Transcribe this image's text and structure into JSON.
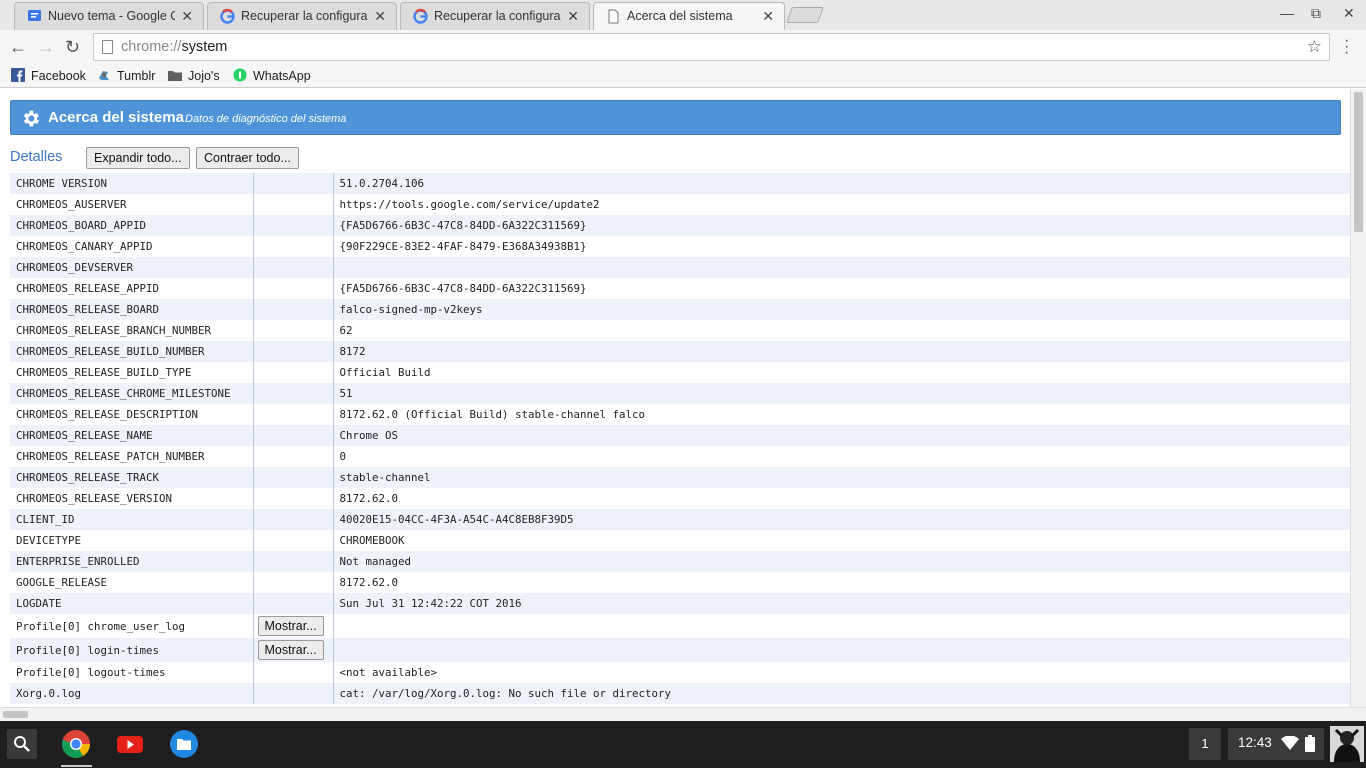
{
  "browser": {
    "tabs": [
      {
        "title": "Nuevo tema - Google Ch",
        "favicon": "comment-icon",
        "active": false
      },
      {
        "title": "Recuperar la configuraci",
        "favicon": "google-icon",
        "active": false
      },
      {
        "title": "Recuperar la configuraci",
        "favicon": "google-icon",
        "active": false
      },
      {
        "title": "Acerca del sistema",
        "favicon": "page-icon",
        "active": true
      }
    ],
    "url_scheme": "chrome://",
    "url_host": "system",
    "bookmarks": [
      {
        "label": "Facebook",
        "icon": "facebook-icon"
      },
      {
        "label": "Tumblr",
        "icon": "tumblr-icon"
      },
      {
        "label": "Jojo's",
        "icon": "folder-icon"
      },
      {
        "label": "WhatsApp",
        "icon": "whatsapp-icon"
      }
    ]
  },
  "page": {
    "title": "Acerca del sistema",
    "subtitle": "Datos de diagnóstico del sistema",
    "details_label": "Detalles",
    "expand_all": "Expandir todo...",
    "collapse_all": "Contraer todo...",
    "show_label": "Mostrar...",
    "rows": [
      {
        "key": "CHROME VERSION",
        "value": "51.0.2704.106"
      },
      {
        "key": "CHROMEOS_AUSERVER",
        "value": "https://tools.google.com/service/update2"
      },
      {
        "key": "CHROMEOS_BOARD_APPID",
        "value": "{FA5D6766-6B3C-47C8-84DD-6A322C311569}"
      },
      {
        "key": "CHROMEOS_CANARY_APPID",
        "value": "{90F229CE-83E2-4FAF-8479-E368A34938B1}"
      },
      {
        "key": "CHROMEOS_DEVSERVER",
        "value": ""
      },
      {
        "key": "CHROMEOS_RELEASE_APPID",
        "value": "{FA5D6766-6B3C-47C8-84DD-6A322C311569}"
      },
      {
        "key": "CHROMEOS_RELEASE_BOARD",
        "value": "falco-signed-mp-v2keys"
      },
      {
        "key": "CHROMEOS_RELEASE_BRANCH_NUMBER",
        "value": "62"
      },
      {
        "key": "CHROMEOS_RELEASE_BUILD_NUMBER",
        "value": "8172"
      },
      {
        "key": "CHROMEOS_RELEASE_BUILD_TYPE",
        "value": "Official Build"
      },
      {
        "key": "CHROMEOS_RELEASE_CHROME_MILESTONE",
        "value": "51"
      },
      {
        "key": "CHROMEOS_RELEASE_DESCRIPTION",
        "value": "8172.62.0 (Official Build) stable-channel falco"
      },
      {
        "key": "CHROMEOS_RELEASE_NAME",
        "value": "Chrome OS"
      },
      {
        "key": "CHROMEOS_RELEASE_PATCH_NUMBER",
        "value": "0"
      },
      {
        "key": "CHROMEOS_RELEASE_TRACK",
        "value": "stable-channel"
      },
      {
        "key": "CHROMEOS_RELEASE_VERSION",
        "value": "8172.62.0"
      },
      {
        "key": "CLIENT_ID",
        "value": "40020E15-04CC-4F3A-A54C-A4C8EB8F39D5"
      },
      {
        "key": "DEVICETYPE",
        "value": "CHROMEBOOK"
      },
      {
        "key": "ENTERPRISE_ENROLLED",
        "value": "Not managed"
      },
      {
        "key": "GOOGLE_RELEASE",
        "value": "8172.62.0"
      },
      {
        "key": "LOGDATE",
        "value": "Sun Jul 31 12:42:22 COT 2016"
      },
      {
        "key": "Profile[0] chrome_user_log",
        "value": "",
        "button": true
      },
      {
        "key": "Profile[0] login-times",
        "value": "",
        "button": true
      },
      {
        "key": "Profile[0] logout-times",
        "value": "<not available>"
      },
      {
        "key": "Xorg.0.log",
        "value": "cat: /var/log/Xorg.0.log: No such file or directory"
      }
    ]
  },
  "shelf": {
    "apps": [
      "search-icon",
      "chrome-icon",
      "youtube-icon",
      "files-icon"
    ],
    "notification_count": "1",
    "clock": "12:43"
  },
  "colors": {
    "header_bg": "#4f94d8",
    "row_alt": "#eef2fb",
    "link_blue": "#3b78c0",
    "shelf_bg": "#1e1e1e"
  }
}
